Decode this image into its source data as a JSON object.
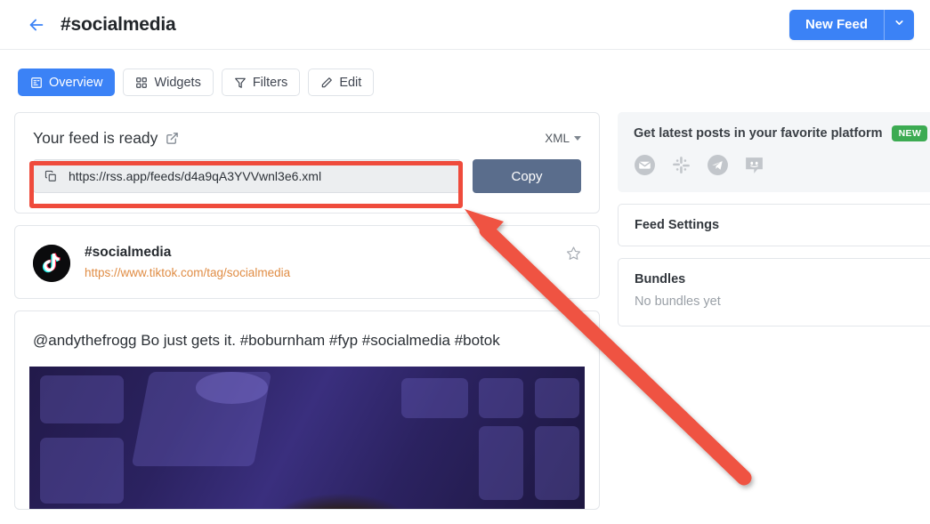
{
  "header": {
    "back_icon": "arrow-left-icon",
    "title": "#socialmedia",
    "new_feed_label": "New Feed",
    "new_feed_caret_icon": "chevron-down-icon",
    "accent_color": "#3b82f6"
  },
  "tabs": [
    {
      "label": "Overview",
      "icon": "document-list-icon",
      "active": true
    },
    {
      "label": "Widgets",
      "icon": "grid-squares-icon",
      "active": false
    },
    {
      "label": "Filters",
      "icon": "funnel-icon",
      "active": false
    },
    {
      "label": "Edit",
      "icon": "pencil-icon",
      "active": false
    }
  ],
  "feed_card": {
    "title": "Your feed is ready",
    "external_link_icon": "external-link-icon",
    "format_label": "XML",
    "format_caret_icon": "caret-down-icon",
    "copy_glyph_icon": "copy-icon",
    "feed_url": "https://rss.app/feeds/d4a9qA3YVVwnl3e6.xml",
    "copy_button_label": "Copy",
    "copy_button_color": "#5a6d8c"
  },
  "source_card": {
    "avatar_icon": "tiktok-logo-icon",
    "name": "#socialmedia",
    "url": "https://www.tiktok.com/tag/socialmedia",
    "url_color": "#e08d45",
    "favorite_icon": "star-outline-icon"
  },
  "post_card": {
    "text": "@andythefrogg Bo just gets it. #boburnham #fyp #socialmedia #botok",
    "media_icon": "video-thumbnail"
  },
  "promo_panel": {
    "title": "Get latest posts in your favorite platform",
    "badge": "NEW",
    "badge_color": "#3cab52",
    "platform_icons": [
      "email-icon",
      "slack-icon",
      "telegram-icon",
      "discord-icon"
    ]
  },
  "feed_settings": {
    "title": "Feed Settings"
  },
  "bundles": {
    "title": "Bundles",
    "empty_text": "No bundles yet"
  },
  "annotation": {
    "highlight_color": "#ef4b3c",
    "arrow_color": "#ef5242",
    "target": "feed-url-field"
  }
}
